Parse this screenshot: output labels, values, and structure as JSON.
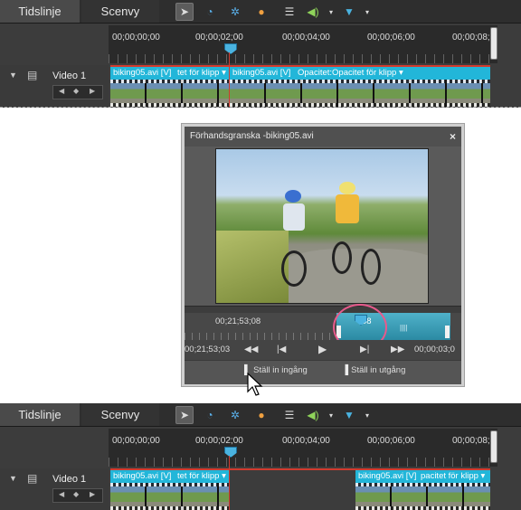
{
  "timeline_panels": [
    {
      "tabs": [
        "Tidslinje",
        "Scenvy"
      ],
      "ruler_times": [
        "00;00;00;00",
        "00;00;02;00",
        "00;00;04;00",
        "00;00;06;00",
        "00;00;08;"
      ],
      "track_name": "Video 1",
      "clips": [
        {
          "file": "biking05.avi [V]",
          "effect": "tet för klipp"
        },
        {
          "file": "biking05.avi [V]",
          "effect": "Opacitet:Opacitet för klipp"
        }
      ]
    },
    {
      "tabs": [
        "Tidslinje",
        "Scenvy"
      ],
      "ruler_times": [
        "00;00;00;00",
        "00;00;02;00",
        "00;00;04;00",
        "00;00;06;00",
        "00;00;08;"
      ],
      "track_name": "Video 1",
      "clips": [
        {
          "file": "biking05.avi [V]",
          "effect": "tet för klipp"
        },
        {
          "file": "biking05.avi [V]",
          "effect": "pacitet för klipp"
        }
      ]
    }
  ],
  "preview": {
    "title": "Förhandsgranska -biking05.avi",
    "close": "×",
    "ruler_time_left": "00;21;53;08",
    "ruler_time_right": "08",
    "current_time": "00;21;53;03",
    "duration": "00;00;03;0",
    "set_in_label": "Ställ in ingång",
    "set_out_label": "Ställ in utgång"
  },
  "icons": [
    "selection-tool-icon",
    "time-stretch-icon",
    "effects-icon",
    "smart-fix-icon",
    "properties-icon",
    "audio-icon",
    "marker-icon",
    "film-strip-icon"
  ]
}
